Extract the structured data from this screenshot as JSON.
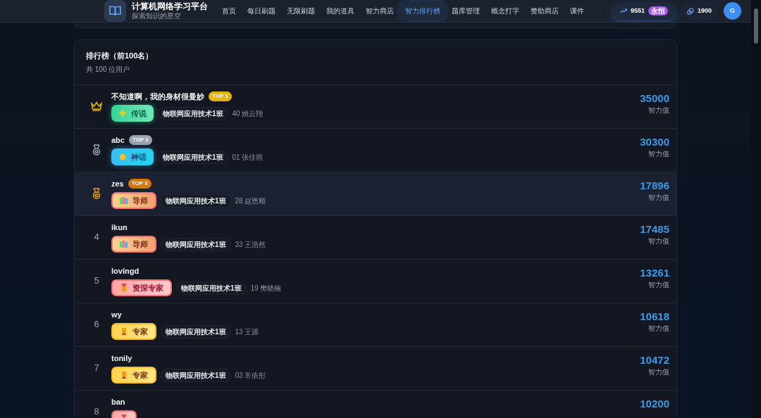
{
  "header": {
    "title": "计算机网络学习平台",
    "subtitle": "探索知识的星空",
    "nav": [
      {
        "label": "首页",
        "selected": false
      },
      {
        "label": "每日刷题",
        "selected": false
      },
      {
        "label": "无限刷题",
        "selected": false
      },
      {
        "label": "我的道具",
        "selected": false
      },
      {
        "label": "智力商店",
        "selected": false
      },
      {
        "label": "智力排行榜",
        "selected": true
      },
      {
        "label": "题库管理",
        "selected": false
      },
      {
        "label": "概念打字",
        "selected": false
      },
      {
        "label": "赞助商店",
        "selected": false
      },
      {
        "label": "课件",
        "selected": false
      }
    ],
    "points": "9551",
    "points_tag": "永恒",
    "coins": "1900",
    "avatar": "G"
  },
  "leaderboard": {
    "title": "排行榜（前100名）",
    "subtitle": "共 100 位用户",
    "rows": [
      {
        "kind": "gold",
        "top": "TOP 1",
        "name": "不知道啊，我的身材很曼妙",
        "badge": {
          "kind": "legend",
          "label": "传说"
        },
        "class": "物联网应用技术1班",
        "student": "40 姚云翔",
        "score": "35000",
        "score_label": "智力值",
        "hovered": false
      },
      {
        "kind": "silver",
        "top": "TOP 2",
        "name": "abc",
        "badge": {
          "kind": "myth",
          "label": "神话"
        },
        "class": "物联网应用技术1班",
        "student": "01 张佳雨",
        "score": "30300",
        "score_label": "智力值",
        "hovered": false
      },
      {
        "kind": "bronze",
        "top": "TOP 3",
        "name": "zes",
        "badge": {
          "kind": "mentor",
          "label": "导师"
        },
        "class": "物联网应用技术1班",
        "student": "28 赵恩顺",
        "score": "17896",
        "score_label": "智力值",
        "hovered": true
      },
      {
        "kind": "number",
        "rank": "4",
        "name": "ikun",
        "badge": {
          "kind": "mentor",
          "label": "导师"
        },
        "class": "物联网应用技术1班",
        "student": "33 王浩然",
        "score": "17485",
        "score_label": "智力值",
        "hovered": false
      },
      {
        "kind": "number",
        "rank": "5",
        "name": "lovingd",
        "badge": {
          "kind": "senior",
          "label": "资深专家"
        },
        "class": "物联网应用技术1班",
        "student": "19 樊晓楠",
        "score": "13261",
        "score_label": "智力值",
        "hovered": false
      },
      {
        "kind": "number",
        "rank": "6",
        "name": "wy",
        "badge": {
          "kind": "expert",
          "label": "专家"
        },
        "class": "物联网应用技术1班",
        "student": "13 王源",
        "score": "10618",
        "score_label": "智力值",
        "hovered": false
      },
      {
        "kind": "number",
        "rank": "7",
        "name": "tonily",
        "badge": {
          "kind": "expert",
          "label": "专家"
        },
        "class": "物联网应用技术1班",
        "student": "03 常依彤",
        "score": "10472",
        "score_label": "智力值",
        "hovered": false
      },
      {
        "kind": "number",
        "rank": "8",
        "name": "ban",
        "badge": {
          "kind": "senior"
        },
        "score": "10200",
        "hovered": false
      }
    ]
  }
}
